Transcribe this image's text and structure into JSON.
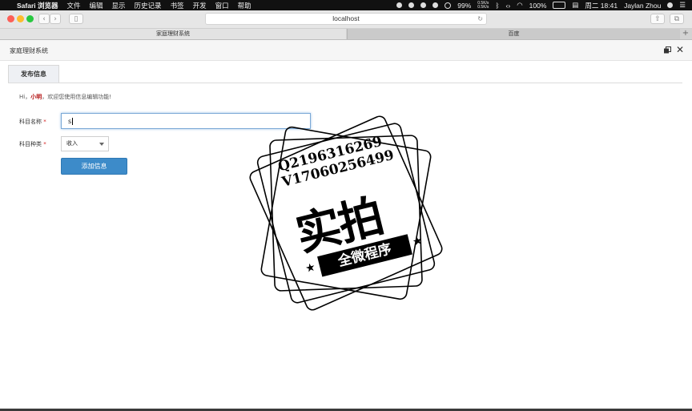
{
  "menubar": {
    "app_name": "Safari 浏览器",
    "menus": [
      "文件",
      "编辑",
      "显示",
      "历史记录",
      "书签",
      "开发",
      "窗口",
      "帮助"
    ],
    "battery_small": "99%",
    "net_up": "0.5K/s",
    "net_down": "0.5K/s",
    "battery": "100%",
    "clock": "周二 18:41",
    "user": "Jaylan Zhou"
  },
  "toolbar": {
    "url": "localhost"
  },
  "tabs": [
    {
      "label": "家庭理财系统",
      "active": true
    },
    {
      "label": "百度",
      "active": false
    }
  ],
  "page": {
    "title": "家庭理财系统",
    "tab_label": "发布信息",
    "greeting": {
      "prefix": "Hi，",
      "username": "小明",
      "suffix": "，欢迎您使用信息编辑功能!"
    },
    "form": {
      "name_label": "科目名称",
      "name_value": "s",
      "type_label": "科目种类",
      "type_value": "收入",
      "submit_label": "添加信息",
      "required_mark": "*"
    }
  },
  "watermark": {
    "line1": "Q2196316269",
    "line2": "V17060256499",
    "big": "实拍",
    "ribbon": "全微程序"
  },
  "colors": {
    "accent": "#3d8bc9",
    "username": "#b31313",
    "required": "#d42020"
  }
}
